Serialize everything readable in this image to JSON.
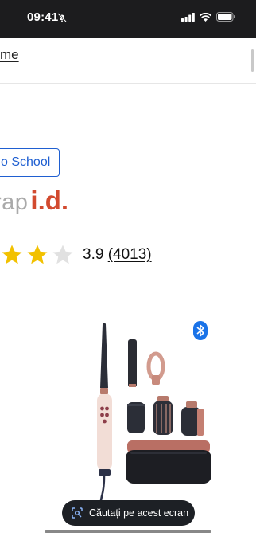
{
  "status_bar": {
    "time": "09:41",
    "icons": [
      "bell-slash-icon",
      "signal-icon",
      "wifi-icon",
      "battery-icon"
    ]
  },
  "nav": {
    "link_text": "me"
  },
  "product": {
    "badge_text": "o School",
    "brand_prefix": "rap",
    "brand_suffix": "i.d.",
    "brand_color": "#d24a2f",
    "badge_color": "#1f5fd1",
    "rating": {
      "value": "3.9",
      "count": "4013",
      "count_display": "(4013)",
      "visible_stars": [
        "filled",
        "filled",
        "empty"
      ],
      "star_color": "#f2c100"
    },
    "connectivity_icon": "bluetooth-icon",
    "image_subject": "hair-styler-kit"
  },
  "overlay": {
    "lens_button_label": "Căutați pe acest ecran",
    "lens_icon": "lens-icon"
  }
}
